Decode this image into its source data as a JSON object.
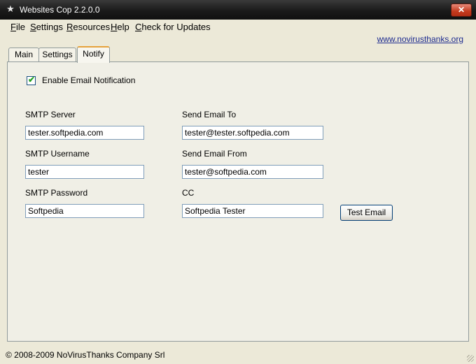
{
  "window": {
    "title": "Websites Cop 2.2.0.0",
    "close_glyph": "✕"
  },
  "menu": [
    {
      "key": "F",
      "rest": "ile"
    },
    {
      "key": "S",
      "rest": "ettings"
    },
    {
      "key": "R",
      "rest": "esources"
    },
    {
      "key": "H",
      "rest": "elp"
    },
    {
      "key": "C",
      "rest": "heck for Updates"
    }
  ],
  "site_link": "www.novirusthanks.org",
  "tabs": [
    {
      "label": "Main",
      "active": false
    },
    {
      "label": "Settings",
      "active": false
    },
    {
      "label": "Notify",
      "active": true
    }
  ],
  "notify": {
    "enable_label": "Enable Email Notification",
    "enable_checked": true,
    "smtp_server_label": "SMTP Server",
    "smtp_server_value": "tester.softpedia.com",
    "send_to_label": "Send Email To",
    "send_to_value": "tester@tester.softpedia.com",
    "smtp_username_label": "SMTP Username",
    "smtp_username_value": "tester",
    "send_from_label": "Send Email From",
    "send_from_value": "tester@softpedia.com",
    "smtp_password_label": "SMTP Password",
    "smtp_password_value": "Softpedia",
    "cc_label": "CC",
    "cc_value": "Softpedia Tester",
    "test_button": "Test Email"
  },
  "status": "© 2008-2009 NoVirusThanks Company Srl"
}
